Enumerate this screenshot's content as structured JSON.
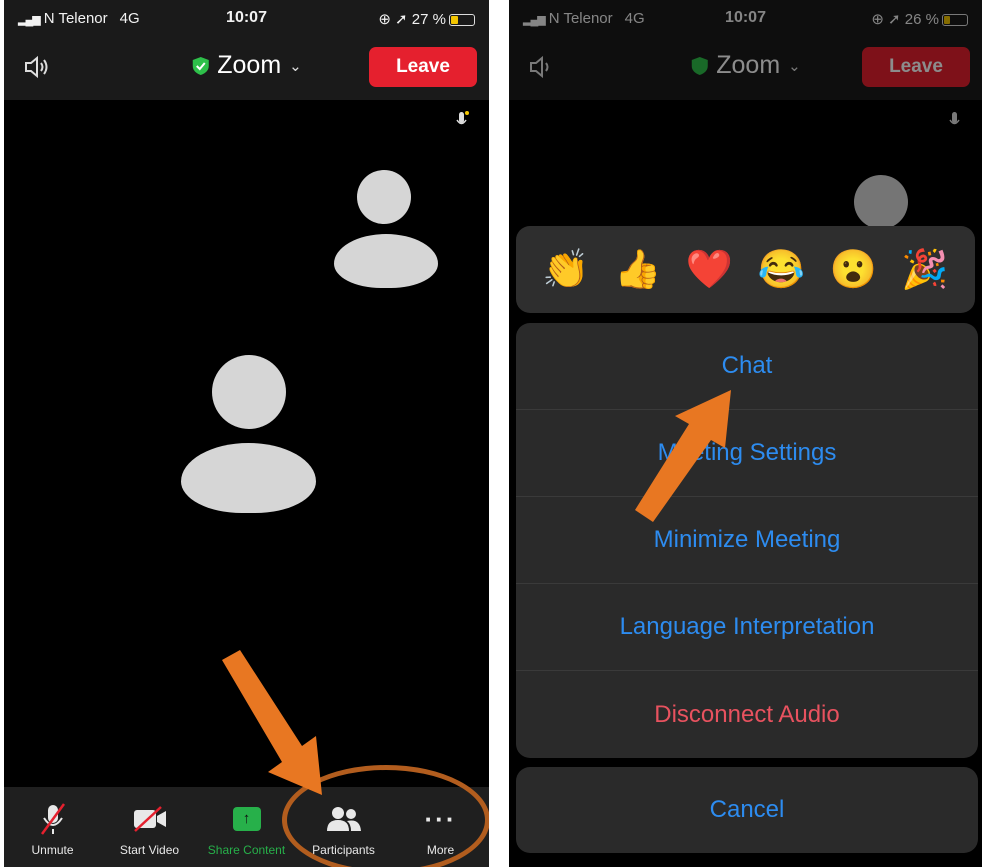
{
  "status_left": {
    "carrier": "N Telenor",
    "network": "4G",
    "time": "10:07",
    "battery": "27 %"
  },
  "status_right": {
    "carrier": "N Telenor",
    "network": "4G",
    "time": "10:07",
    "battery": "26 %"
  },
  "header": {
    "title": "Zoom",
    "leave_label": "Leave"
  },
  "toolbar": {
    "items": [
      {
        "label": "Unmute",
        "icon": "muted-mic-icon"
      },
      {
        "label": "Start Video",
        "icon": "video-off-icon"
      },
      {
        "label": "Share Content",
        "icon": "share-screen-icon"
      },
      {
        "label": "Participants",
        "icon": "participants-icon"
      },
      {
        "label": "More",
        "icon": "more-dots-icon"
      }
    ]
  },
  "reactions": [
    {
      "emoji": "👏",
      "icon": "clap-icon"
    },
    {
      "emoji": "👍",
      "icon": "thumbs-up-icon"
    },
    {
      "emoji": "❤️",
      "icon": "heart-icon"
    },
    {
      "emoji": "😂",
      "icon": "laughing-icon"
    },
    {
      "emoji": "😮",
      "icon": "surprised-icon"
    },
    {
      "emoji": "🎉",
      "icon": "party-icon"
    }
  ],
  "menu": {
    "items": [
      {
        "label": "Chat"
      },
      {
        "label": "Meeting Settings"
      },
      {
        "label": "Minimize Meeting"
      },
      {
        "label": "Language Interpretation"
      },
      {
        "label": "Disconnect Audio"
      }
    ],
    "cancel_label": "Cancel"
  },
  "colors": {
    "leave_red": "#e5202e",
    "menu_blue": "#2d8cf0",
    "danger_red": "#e8525f",
    "share_green": "#27b04a",
    "annotation_orange": "#e87722"
  }
}
